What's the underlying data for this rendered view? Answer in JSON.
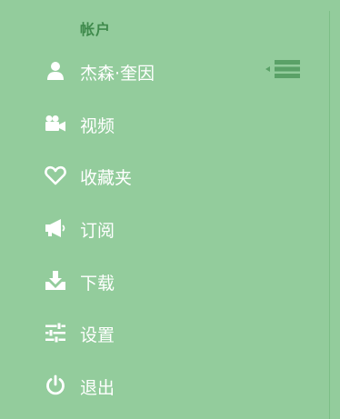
{
  "colors": {
    "background": "#93cc9c",
    "title": "#3f8a4c",
    "text": "#ffffff",
    "accent": "#5aa167"
  },
  "section": {
    "title": "帐户"
  },
  "menu": {
    "items": [
      {
        "label": "杰森·奎因",
        "icon": "user-icon"
      },
      {
        "label": "视频",
        "icon": "video-camera-icon"
      },
      {
        "label": "收藏夹",
        "icon": "heart-icon"
      },
      {
        "label": "订阅",
        "icon": "megaphone-icon"
      },
      {
        "label": "下载",
        "icon": "download-icon"
      },
      {
        "label": "设置",
        "icon": "sliders-icon"
      },
      {
        "label": "退出",
        "icon": "power-icon"
      }
    ]
  },
  "collapse_handle": {
    "icon": "menu-collapse-icon"
  }
}
